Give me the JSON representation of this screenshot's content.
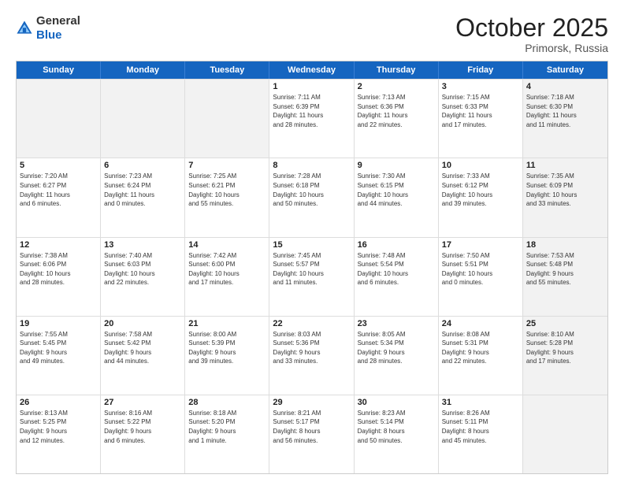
{
  "header": {
    "logo_general": "General",
    "logo_blue": "Blue",
    "month": "October 2025",
    "location": "Primorsk, Russia"
  },
  "days_of_week": [
    "Sunday",
    "Monday",
    "Tuesday",
    "Wednesday",
    "Thursday",
    "Friday",
    "Saturday"
  ],
  "weeks": [
    [
      {
        "day": "",
        "info": "",
        "shaded": true
      },
      {
        "day": "",
        "info": "",
        "shaded": true
      },
      {
        "day": "",
        "info": "",
        "shaded": true
      },
      {
        "day": "1",
        "info": "Sunrise: 7:11 AM\nSunset: 6:39 PM\nDaylight: 11 hours\nand 28 minutes.",
        "shaded": false
      },
      {
        "day": "2",
        "info": "Sunrise: 7:13 AM\nSunset: 6:36 PM\nDaylight: 11 hours\nand 22 minutes.",
        "shaded": false
      },
      {
        "day": "3",
        "info": "Sunrise: 7:15 AM\nSunset: 6:33 PM\nDaylight: 11 hours\nand 17 minutes.",
        "shaded": false
      },
      {
        "day": "4",
        "info": "Sunrise: 7:18 AM\nSunset: 6:30 PM\nDaylight: 11 hours\nand 11 minutes.",
        "shaded": true
      }
    ],
    [
      {
        "day": "5",
        "info": "Sunrise: 7:20 AM\nSunset: 6:27 PM\nDaylight: 11 hours\nand 6 minutes.",
        "shaded": false
      },
      {
        "day": "6",
        "info": "Sunrise: 7:23 AM\nSunset: 6:24 PM\nDaylight: 11 hours\nand 0 minutes.",
        "shaded": false
      },
      {
        "day": "7",
        "info": "Sunrise: 7:25 AM\nSunset: 6:21 PM\nDaylight: 10 hours\nand 55 minutes.",
        "shaded": false
      },
      {
        "day": "8",
        "info": "Sunrise: 7:28 AM\nSunset: 6:18 PM\nDaylight: 10 hours\nand 50 minutes.",
        "shaded": false
      },
      {
        "day": "9",
        "info": "Sunrise: 7:30 AM\nSunset: 6:15 PM\nDaylight: 10 hours\nand 44 minutes.",
        "shaded": false
      },
      {
        "day": "10",
        "info": "Sunrise: 7:33 AM\nSunset: 6:12 PM\nDaylight: 10 hours\nand 39 minutes.",
        "shaded": false
      },
      {
        "day": "11",
        "info": "Sunrise: 7:35 AM\nSunset: 6:09 PM\nDaylight: 10 hours\nand 33 minutes.",
        "shaded": true
      }
    ],
    [
      {
        "day": "12",
        "info": "Sunrise: 7:38 AM\nSunset: 6:06 PM\nDaylight: 10 hours\nand 28 minutes.",
        "shaded": false
      },
      {
        "day": "13",
        "info": "Sunrise: 7:40 AM\nSunset: 6:03 PM\nDaylight: 10 hours\nand 22 minutes.",
        "shaded": false
      },
      {
        "day": "14",
        "info": "Sunrise: 7:42 AM\nSunset: 6:00 PM\nDaylight: 10 hours\nand 17 minutes.",
        "shaded": false
      },
      {
        "day": "15",
        "info": "Sunrise: 7:45 AM\nSunset: 5:57 PM\nDaylight: 10 hours\nand 11 minutes.",
        "shaded": false
      },
      {
        "day": "16",
        "info": "Sunrise: 7:48 AM\nSunset: 5:54 PM\nDaylight: 10 hours\nand 6 minutes.",
        "shaded": false
      },
      {
        "day": "17",
        "info": "Sunrise: 7:50 AM\nSunset: 5:51 PM\nDaylight: 10 hours\nand 0 minutes.",
        "shaded": false
      },
      {
        "day": "18",
        "info": "Sunrise: 7:53 AM\nSunset: 5:48 PM\nDaylight: 9 hours\nand 55 minutes.",
        "shaded": true
      }
    ],
    [
      {
        "day": "19",
        "info": "Sunrise: 7:55 AM\nSunset: 5:45 PM\nDaylight: 9 hours\nand 49 minutes.",
        "shaded": false
      },
      {
        "day": "20",
        "info": "Sunrise: 7:58 AM\nSunset: 5:42 PM\nDaylight: 9 hours\nand 44 minutes.",
        "shaded": false
      },
      {
        "day": "21",
        "info": "Sunrise: 8:00 AM\nSunset: 5:39 PM\nDaylight: 9 hours\nand 39 minutes.",
        "shaded": false
      },
      {
        "day": "22",
        "info": "Sunrise: 8:03 AM\nSunset: 5:36 PM\nDaylight: 9 hours\nand 33 minutes.",
        "shaded": false
      },
      {
        "day": "23",
        "info": "Sunrise: 8:05 AM\nSunset: 5:34 PM\nDaylight: 9 hours\nand 28 minutes.",
        "shaded": false
      },
      {
        "day": "24",
        "info": "Sunrise: 8:08 AM\nSunset: 5:31 PM\nDaylight: 9 hours\nand 22 minutes.",
        "shaded": false
      },
      {
        "day": "25",
        "info": "Sunrise: 8:10 AM\nSunset: 5:28 PM\nDaylight: 9 hours\nand 17 minutes.",
        "shaded": true
      }
    ],
    [
      {
        "day": "26",
        "info": "Sunrise: 8:13 AM\nSunset: 5:25 PM\nDaylight: 9 hours\nand 12 minutes.",
        "shaded": false
      },
      {
        "day": "27",
        "info": "Sunrise: 8:16 AM\nSunset: 5:22 PM\nDaylight: 9 hours\nand 6 minutes.",
        "shaded": false
      },
      {
        "day": "28",
        "info": "Sunrise: 8:18 AM\nSunset: 5:20 PM\nDaylight: 9 hours\nand 1 minute.",
        "shaded": false
      },
      {
        "day": "29",
        "info": "Sunrise: 8:21 AM\nSunset: 5:17 PM\nDaylight: 8 hours\nand 56 minutes.",
        "shaded": false
      },
      {
        "day": "30",
        "info": "Sunrise: 8:23 AM\nSunset: 5:14 PM\nDaylight: 8 hours\nand 50 minutes.",
        "shaded": false
      },
      {
        "day": "31",
        "info": "Sunrise: 8:26 AM\nSunset: 5:11 PM\nDaylight: 8 hours\nand 45 minutes.",
        "shaded": false
      },
      {
        "day": "",
        "info": "",
        "shaded": true
      }
    ]
  ]
}
